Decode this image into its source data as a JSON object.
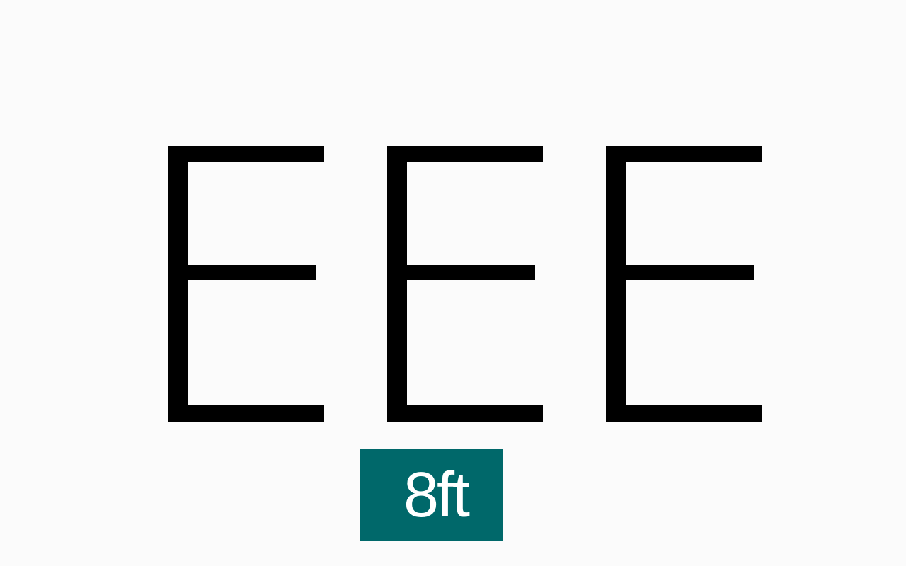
{
  "letters": [
    {
      "char": "E",
      "orientation": "right"
    },
    {
      "char": "E",
      "orientation": "right"
    },
    {
      "char": "E",
      "orientation": "right"
    }
  ],
  "distance": {
    "label": "8ft"
  },
  "colors": {
    "background": "#fbfbfb",
    "letter": "#000000",
    "badge_background": "#00686a",
    "badge_text": "#ffffff"
  }
}
